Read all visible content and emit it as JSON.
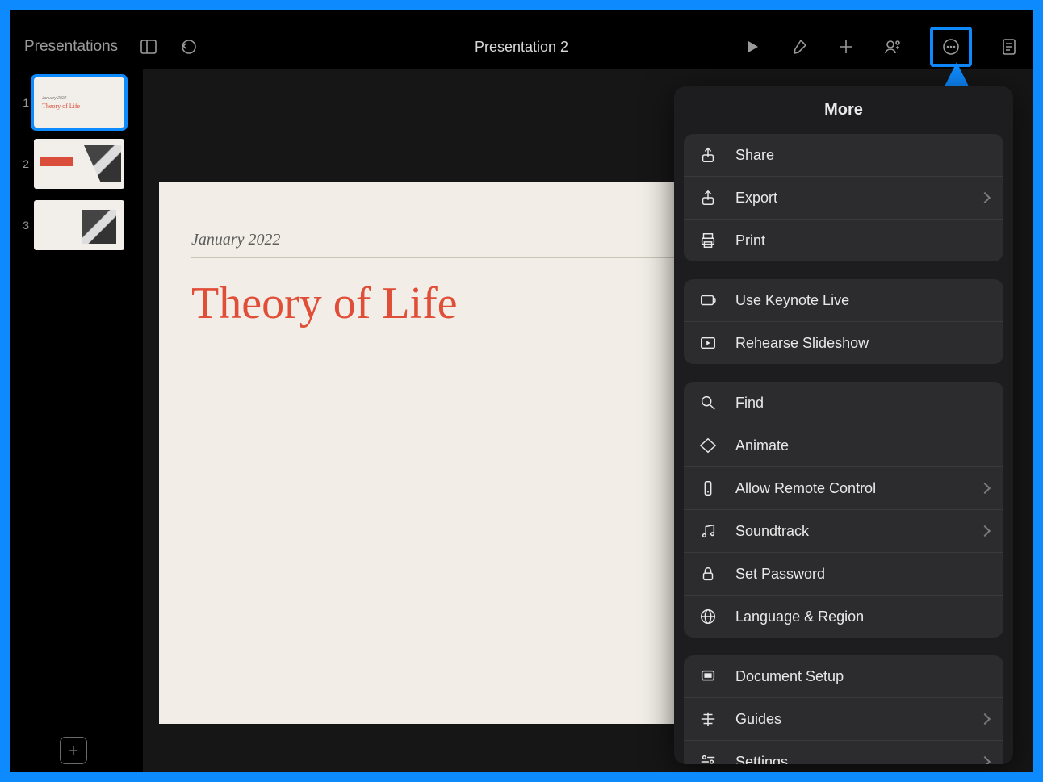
{
  "toolbar": {
    "back_label": "Presentations",
    "title": "Presentation 2"
  },
  "slide": {
    "date": "January 2022",
    "title": "Theory of Life"
  },
  "thumbs": {
    "t1": {
      "num": "1",
      "date": "January 2022",
      "title": "Theory of Life"
    },
    "t2": {
      "num": "2"
    },
    "t3": {
      "num": "3"
    }
  },
  "popover": {
    "title": "More",
    "g1": {
      "share": "Share",
      "export": "Export",
      "print": "Print"
    },
    "g2": {
      "live": "Use Keynote Live",
      "rehearse": "Rehearse Slideshow"
    },
    "g3": {
      "find": "Find",
      "animate": "Animate",
      "remote": "Allow Remote Control",
      "soundtrack": "Soundtrack",
      "password": "Set Password",
      "lang": "Language & Region"
    },
    "g4": {
      "docsetup": "Document Setup",
      "guides": "Guides",
      "settings": "Settings"
    }
  }
}
